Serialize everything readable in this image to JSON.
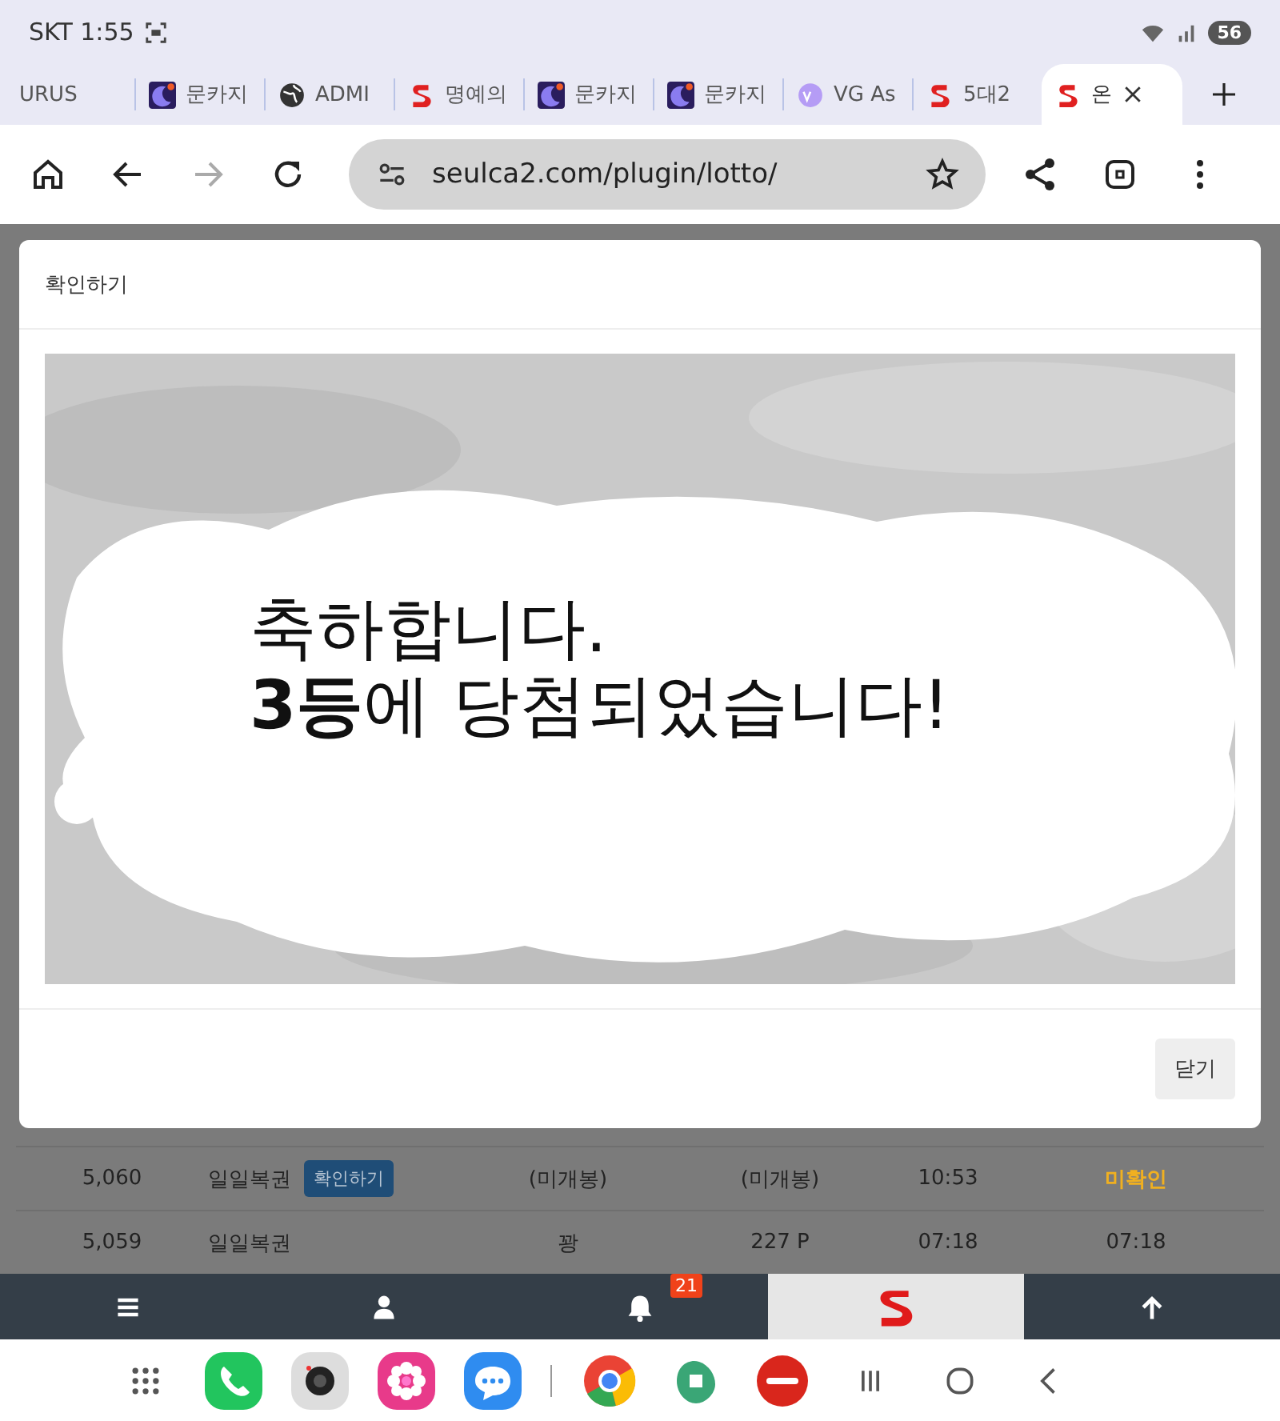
{
  "status_bar": {
    "carrier_time": "SKT 1:55",
    "battery": "56"
  },
  "tabs": [
    {
      "label": "URUS",
      "kind": "plain",
      "selected": false
    },
    {
      "label": "문카지",
      "kind": "moon",
      "selected": false
    },
    {
      "label": "ADMI",
      "kind": "globe",
      "selected": false
    },
    {
      "label": "명예의",
      "kind": "s",
      "selected": false
    },
    {
      "label": "문카지",
      "kind": "moon",
      "selected": false
    },
    {
      "label": "문카지",
      "kind": "moon",
      "selected": false
    },
    {
      "label": "VG As",
      "kind": "vg",
      "selected": false
    },
    {
      "label": "5대2",
      "kind": "s",
      "selected": false
    },
    {
      "label": "온",
      "kind": "s",
      "selected": true
    }
  ],
  "address_bar": {
    "url": "seulca2.com/plugin/lotto/"
  },
  "modal": {
    "title": "확인하기",
    "message": [
      "축하합니다.",
      "**3등**에 당첨되었습니다!"
    ],
    "close_button": "닫기"
  },
  "rows": [
    {
      "number": "5,060",
      "name": "일일복권",
      "action": "확인하기",
      "column_4": "(미개봉)",
      "column_5": "(미개봉)",
      "time": "10:53",
      "status": "미확인",
      "kind": "pending"
    },
    {
      "number": "5,059",
      "name": "일일복권",
      "column_4": "꽝",
      "column_5": "227 P",
      "time": "07:18",
      "status": "07:18",
      "kind": "time"
    }
  ],
  "bottom_nav": [
    {
      "kind": "menu",
      "selected": false
    },
    {
      "kind": "user",
      "selected": false
    },
    {
      "kind": "bell",
      "badge": "21",
      "selected": false
    },
    {
      "kind": "logo",
      "selected": true
    },
    {
      "kind": "up",
      "selected": false
    }
  ]
}
